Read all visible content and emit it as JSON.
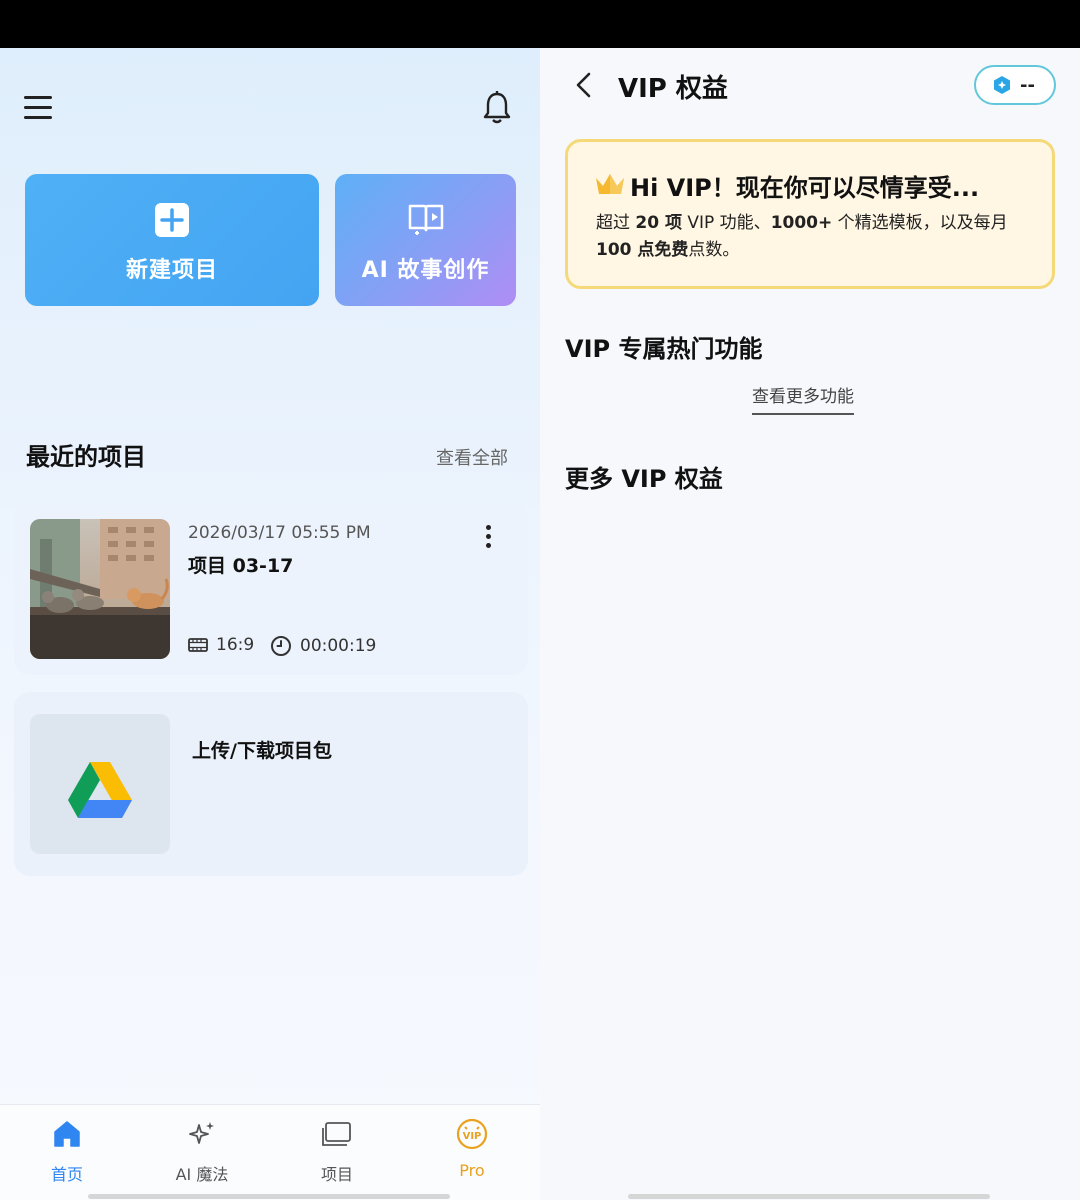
{
  "left": {
    "buttons": {
      "new_project": "新建项目",
      "ai_story": "AI 故事创作"
    },
    "recent": {
      "title": "最近的项目",
      "view_all": "查看全部",
      "project": {
        "datetime": "2026/03/17   05:55 PM",
        "name": "项目 03-17",
        "ratio": "16:9",
        "duration": "00:00:19"
      }
    },
    "upload": {
      "label": "上传/下载项目包"
    },
    "tabs": [
      {
        "label": "首页",
        "icon": "home-icon",
        "active": true
      },
      {
        "label": "AI 魔法",
        "icon": "sparkle-icon",
        "active": false
      },
      {
        "label": "项目",
        "icon": "folder-icon",
        "active": false
      },
      {
        "label": "Pro",
        "icon": "vip-badge-icon",
        "active": false
      }
    ]
  },
  "right": {
    "title": "VIP 权益",
    "pill_value": "--",
    "vip_card": {
      "headline": "Hi VIP！现在你可以尽情享受...",
      "body_parts": [
        "超过 ",
        "20 项",
        " VIP 功能、",
        "1000+",
        " 个精选模板，以及每月 ",
        "100 点免费",
        "点数。"
      ]
    },
    "section_hot": "VIP 专属热门功能",
    "see_more": "查看更多功能",
    "section_more": "更多 VIP 权益"
  },
  "colors": {
    "accent_blue": "#2f86f0",
    "pro_gold": "#e8a21e",
    "vip_border": "#f5d979"
  }
}
